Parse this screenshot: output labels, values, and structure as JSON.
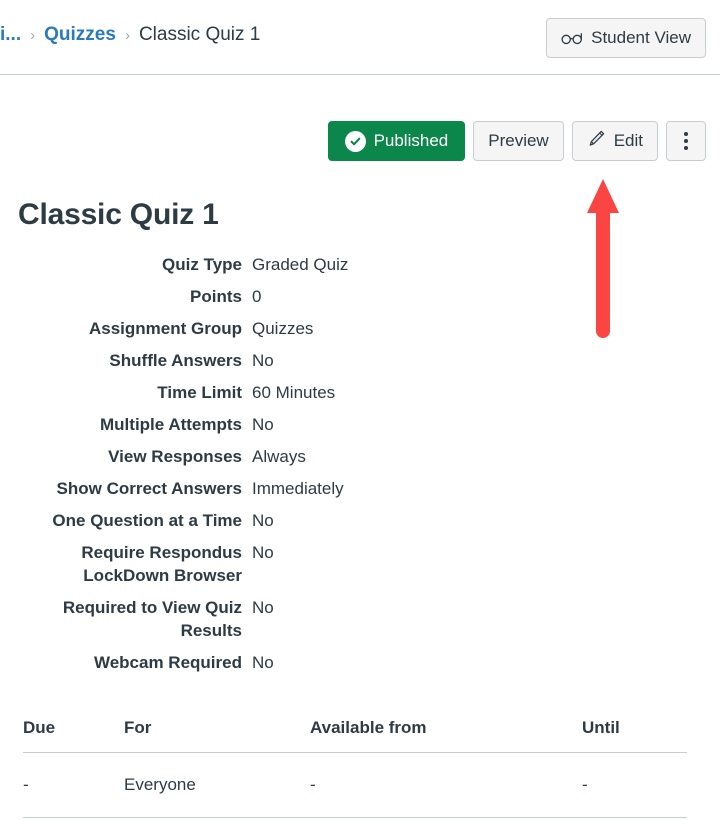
{
  "breadcrumb": {
    "course": "i...",
    "separator": "›",
    "section": "Quizzes",
    "current": "Classic Quiz 1"
  },
  "header": {
    "student_view_label": "Student View",
    "student_view_icon": "glasses-icon"
  },
  "actions": {
    "published_label": "Published",
    "published_icon": "check-circle-icon",
    "preview_label": "Preview",
    "edit_label": "Edit",
    "edit_icon": "pencil-icon",
    "more_icon": "kebab-menu-icon"
  },
  "page": {
    "title": "Classic Quiz 1"
  },
  "details": [
    {
      "label": "Quiz Type",
      "value": "Graded Quiz"
    },
    {
      "label": "Points",
      "value": "0"
    },
    {
      "label": "Assignment Group",
      "value": "Quizzes"
    },
    {
      "label": "Shuffle Answers",
      "value": "No"
    },
    {
      "label": "Time Limit",
      "value": "60 Minutes"
    },
    {
      "label": "Multiple Attempts",
      "value": "No"
    },
    {
      "label": "View Responses",
      "value": "Always"
    },
    {
      "label": "Show Correct Answers",
      "value": "Immediately"
    },
    {
      "label": "One Question at a Time",
      "value": "No"
    },
    {
      "label": "Require Respondus LockDown Browser",
      "value": "No"
    },
    {
      "label": "Required to View Quiz Results",
      "value": "No"
    },
    {
      "label": "Webcam Required",
      "value": "No"
    }
  ],
  "due_table": {
    "headers": [
      "Due",
      "For",
      "Available from",
      "Until"
    ],
    "rows": [
      {
        "due": "-",
        "for": "Everyone",
        "available_from": "-",
        "until": "-"
      }
    ]
  },
  "annotation": {
    "arrow_color": "#fa4542",
    "points_to": "edit-button"
  },
  "colors": {
    "published_green": "#0b874b",
    "link_blue": "#2b7abc",
    "text": "#2d3b45",
    "border": "#c7cdd1",
    "button_bg": "#f5f5f5"
  }
}
